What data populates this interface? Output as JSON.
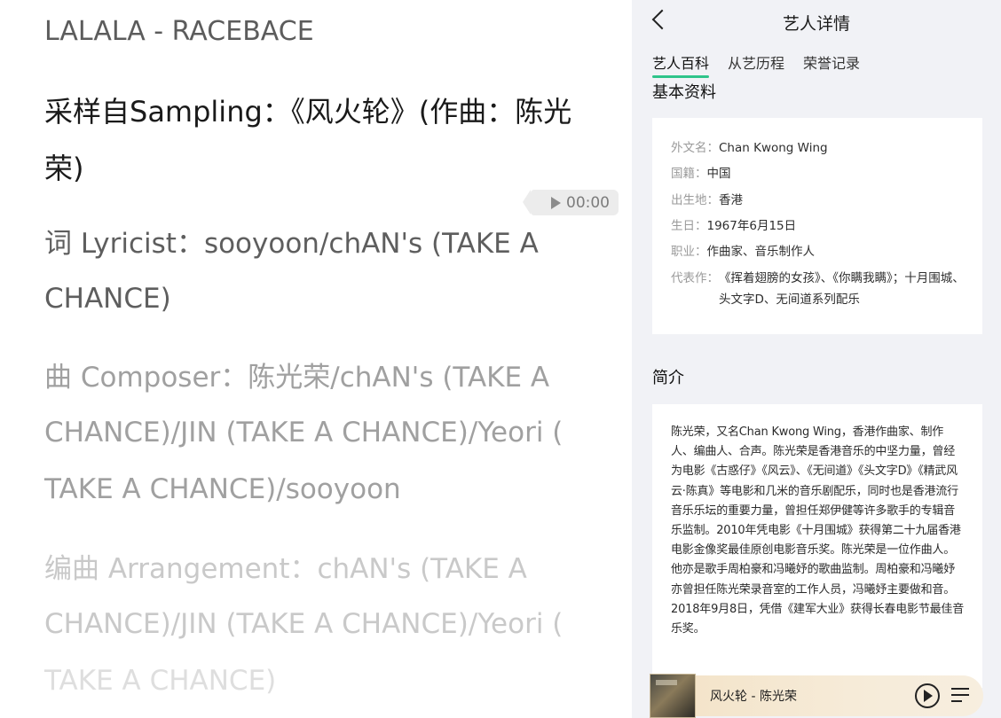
{
  "lyrics": {
    "title": "LALALA - RACEBACE",
    "sampling_line1": "采样自Sampling：《风火轮》(作曲：陈光",
    "sampling_line2": "荣)",
    "lyricist_line1": "词 Lyricist：sooyoon/chAN's (TAKE A",
    "lyricist_line2": "CHANCE)",
    "composer_line1": "曲 Composer：陈光荣/chAN's (TAKE A",
    "composer_line2": "CHANCE)/JIN (TAKE A CHANCE)/Yeori (",
    "composer_line3": "TAKE A CHANCE)/sooyoon",
    "arranger_line1": "编曲 Arrangement：chAN's (TAKE A",
    "arranger_line2": "CHANCE)/JIN (TAKE A CHANCE)/Yeori (",
    "arranger_line3": "TAKE A CHANCE)",
    "time_label": "00:00"
  },
  "artist": {
    "page_title": "艺人详情",
    "tabs": [
      {
        "label": "艺人百科",
        "active": true
      },
      {
        "label": "从艺历程",
        "active": false
      },
      {
        "label": "荣誉记录",
        "active": false
      }
    ],
    "basic_heading": "基本资料",
    "basic_info": [
      {
        "key": "外文名：",
        "value": "Chan Kwong Wing"
      },
      {
        "key": "国籍：",
        "value": "中国"
      },
      {
        "key": "出生地：",
        "value": "香港"
      },
      {
        "key": "生日：",
        "value": "1967年6月15日"
      },
      {
        "key": "职业：",
        "value": "作曲家、音乐制作人"
      },
      {
        "key": "代表作：",
        "value": "《挥着翅膀的女孩》、《你瞒我瞒》；十月围城、头文字D、无间道系列配乐"
      }
    ],
    "intro_heading": "简介",
    "intro_paragraph1": "陈光荣，又名Chan Kwong Wing，香港作曲家、制作人、编曲人、合声。陈光荣是香港音乐的中坚力量，曾经为电影《古惑仔》《风云》、《无间道》《头文字D》《精武风云·陈真》等电影和几米的音乐剧配乐，同时也是香港流行音乐乐坛的重要力量，曾担任郑伊健等许多歌手的专辑音乐监制。2010年凭电影《十月围城》获得第二十九届香港电影金像奖最佳原创电影音乐奖。陈光荣是一位作曲人。他亦是歌手周柏豪和冯曦妤的歌曲监制。周柏豪和冯曦妤亦曾担任陈光荣录音室的工作人员，冯曦妤主要做和音。",
    "intro_paragraph2": "2018年9月8日，凭借《建军大业》获得长春电影节最佳音乐奖。"
  },
  "player": {
    "now_playing": "风火轮 - 陈光荣",
    "accent_color": "#2fc48a"
  }
}
